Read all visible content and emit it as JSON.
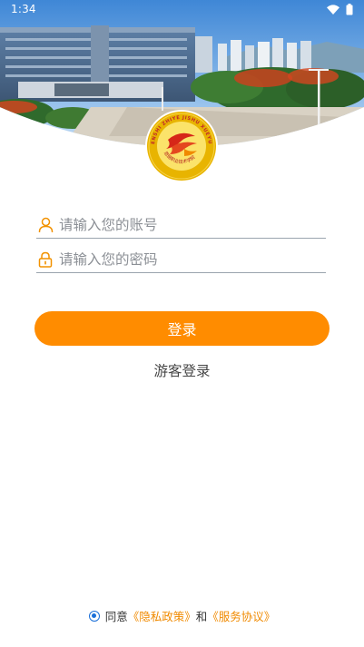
{
  "status_bar": {
    "time": "1:34",
    "icons": [
      "wifi-icon",
      "battery-icon"
    ]
  },
  "hero": {
    "description_icon": "campus-building-photo"
  },
  "logo": {
    "ring_text": "ENSHI ZHIYE JISHU XUEYUAN",
    "inner_text": "恩施职业技术学院",
    "colors": {
      "outer": "#e8b400",
      "inner": "#fbe36a",
      "flag": "#d62718"
    }
  },
  "form": {
    "account": {
      "placeholder": "请输入您的账号",
      "value": "",
      "icon": "user-icon"
    },
    "password": {
      "placeholder": "请输入您的密码",
      "value": "",
      "icon": "lock-icon"
    }
  },
  "actions": {
    "login_label": "登录",
    "guest_label": "游客登录"
  },
  "agreement": {
    "checked": true,
    "prefix": "同意",
    "privacy_link": "《隐私政策》",
    "conjunction": "和",
    "service_link": "《服务协议》"
  },
  "colors": {
    "accent": "#ff8c00",
    "link": "#f08a00",
    "radio": "#1b6fd8",
    "underline": "#9aa4ae"
  }
}
